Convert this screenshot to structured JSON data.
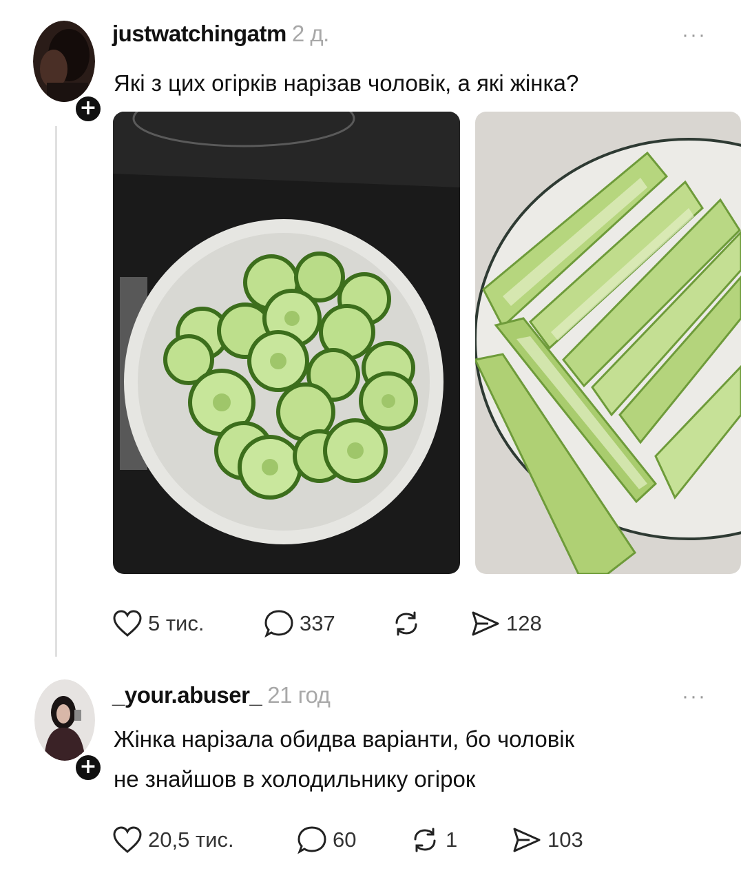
{
  "post1": {
    "username": "justwatchingatm",
    "time": "2 д.",
    "more": "···",
    "text": "Які з цих огірків нарізав чоловік, а які жінка?",
    "images": [
      "sliced-cucumbers-photo",
      "cucumber-sticks-photo"
    ],
    "likes": "5 тис.",
    "comments": "337",
    "reposts": "",
    "shares": "128"
  },
  "post2": {
    "username": "_your.abuser_",
    "time": "21 год",
    "more": "···",
    "text_line1": "Жінка нарізала обидва варіанти, бо чоловік",
    "text_line2": "не знайшов в холодильнику огірок",
    "likes": "20,5 тис.",
    "comments": "60",
    "reposts": "1",
    "shares": "103"
  },
  "colors": {
    "text": "#111111",
    "muted": "#a8a8a8",
    "cucumber": "#8cc24a"
  },
  "icons": [
    "plus-icon",
    "more-icon",
    "heart-icon",
    "comment-icon",
    "repost-icon",
    "share-icon"
  ]
}
